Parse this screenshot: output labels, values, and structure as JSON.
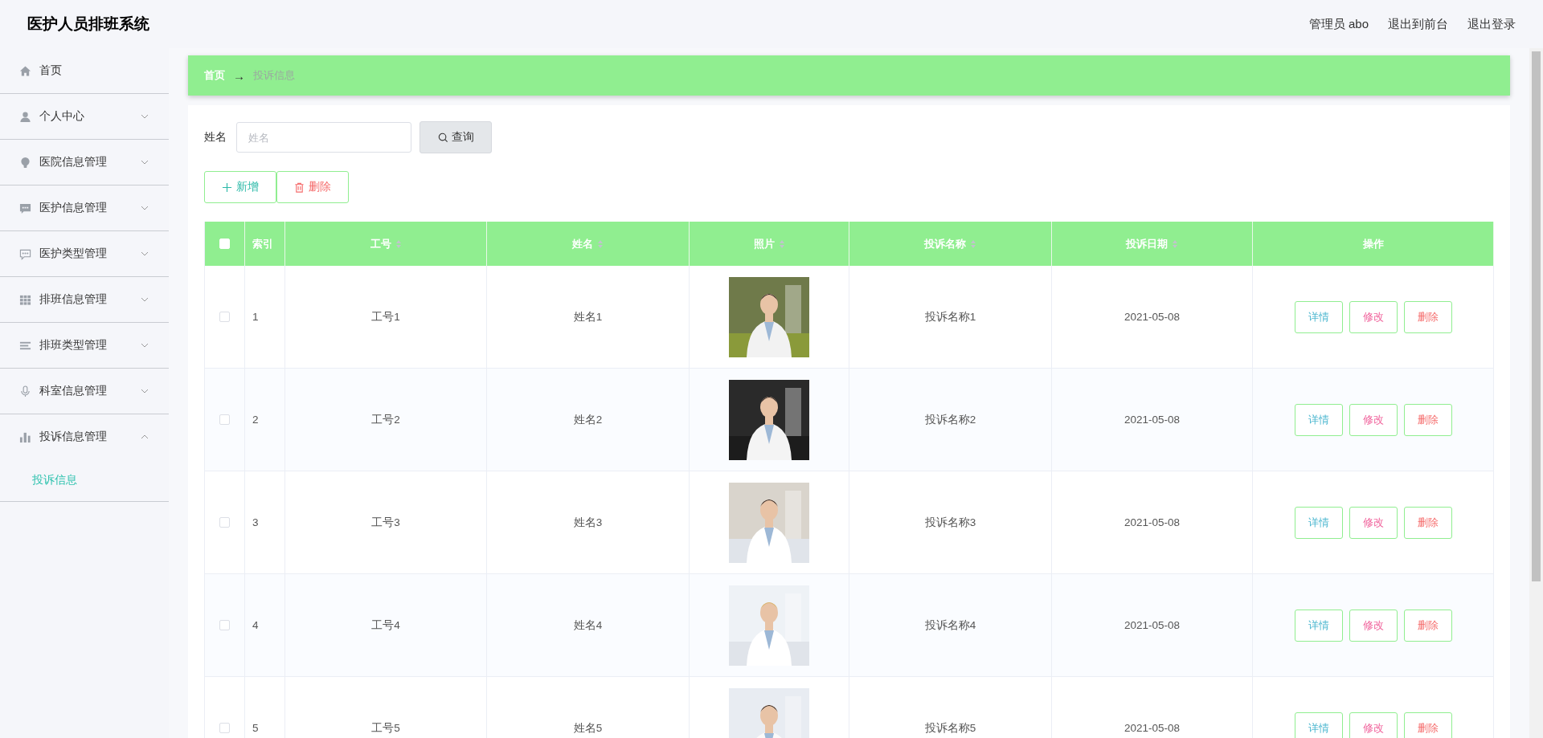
{
  "header": {
    "title": "医护人员排班系统",
    "links": [
      "管理员 abo",
      "退出到前台",
      "退出登录"
    ]
  },
  "sidebar": {
    "items": [
      {
        "label": "首页",
        "expandable": false
      },
      {
        "label": "个人中心",
        "expandable": true,
        "expanded": false
      },
      {
        "label": "医院信息管理",
        "expandable": true,
        "expanded": false
      },
      {
        "label": "医护信息管理",
        "expandable": true,
        "expanded": false
      },
      {
        "label": "医护类型管理",
        "expandable": true,
        "expanded": false
      },
      {
        "label": "排班信息管理",
        "expandable": true,
        "expanded": false
      },
      {
        "label": "排班类型管理",
        "expandable": true,
        "expanded": false
      },
      {
        "label": "科室信息管理",
        "expandable": true,
        "expanded": false
      },
      {
        "label": "投诉信息管理",
        "expandable": true,
        "expanded": true,
        "children": [
          {
            "label": "投诉信息",
            "selected": true
          }
        ]
      }
    ]
  },
  "breadcrumb": {
    "items": [
      "首页",
      "投诉信息"
    ],
    "separator": "→"
  },
  "search": {
    "label": "姓名",
    "placeholder": "姓名",
    "button": "查询"
  },
  "actions": [
    {
      "label": "新增",
      "kind": "add"
    },
    {
      "label": "删除",
      "kind": "delete"
    }
  ],
  "table": {
    "select_all_checked": false,
    "columns": [
      {
        "label": "索引",
        "sortable": false
      },
      {
        "label": "工号",
        "sortable": true
      },
      {
        "label": "姓名",
        "sortable": true
      },
      {
        "label": "照片",
        "sortable": true
      },
      {
        "label": "投诉名称",
        "sortable": true
      },
      {
        "label": "投诉日期",
        "sortable": true
      },
      {
        "label": "操作",
        "sortable": false
      }
    ],
    "rows": [
      {
        "checked": false,
        "index": "1",
        "id": "工号1",
        "name": "姓名1",
        "title": "投诉名称1",
        "date": "2021-05-08",
        "buttons": [
          {
            "label": "详情",
            "kind": "detail"
          },
          {
            "label": "修改",
            "kind": "edit"
          },
          {
            "label": "删除",
            "kind": "delete"
          }
        ]
      },
      {
        "checked": false,
        "index": "2",
        "id": "工号2",
        "name": "姓名2",
        "title": "投诉名称2",
        "date": "2021-05-08",
        "buttons": [
          {
            "label": "详情",
            "kind": "detail"
          },
          {
            "label": "修改",
            "kind": "edit"
          },
          {
            "label": "删除",
            "kind": "delete"
          }
        ]
      },
      {
        "checked": false,
        "index": "3",
        "id": "工号3",
        "name": "姓名3",
        "title": "投诉名称3",
        "date": "2021-05-08",
        "buttons": [
          {
            "label": "详情",
            "kind": "detail"
          },
          {
            "label": "修改",
            "kind": "edit"
          },
          {
            "label": "删除",
            "kind": "delete"
          }
        ]
      },
      {
        "checked": false,
        "index": "4",
        "id": "工号4",
        "name": "姓名4",
        "title": "投诉名称4",
        "date": "2021-05-08",
        "buttons": [
          {
            "label": "详情",
            "kind": "detail"
          },
          {
            "label": "修改",
            "kind": "edit"
          },
          {
            "label": "删除",
            "kind": "delete"
          }
        ]
      },
      {
        "checked": false,
        "index": "5",
        "id": "工号5",
        "name": "姓名5",
        "title": "投诉名称5",
        "date": "2021-05-08",
        "buttons": [
          {
            "label": "详情",
            "kind": "detail"
          },
          {
            "label": "修改",
            "kind": "edit"
          },
          {
            "label": "删除",
            "kind": "delete"
          }
        ]
      }
    ]
  }
}
